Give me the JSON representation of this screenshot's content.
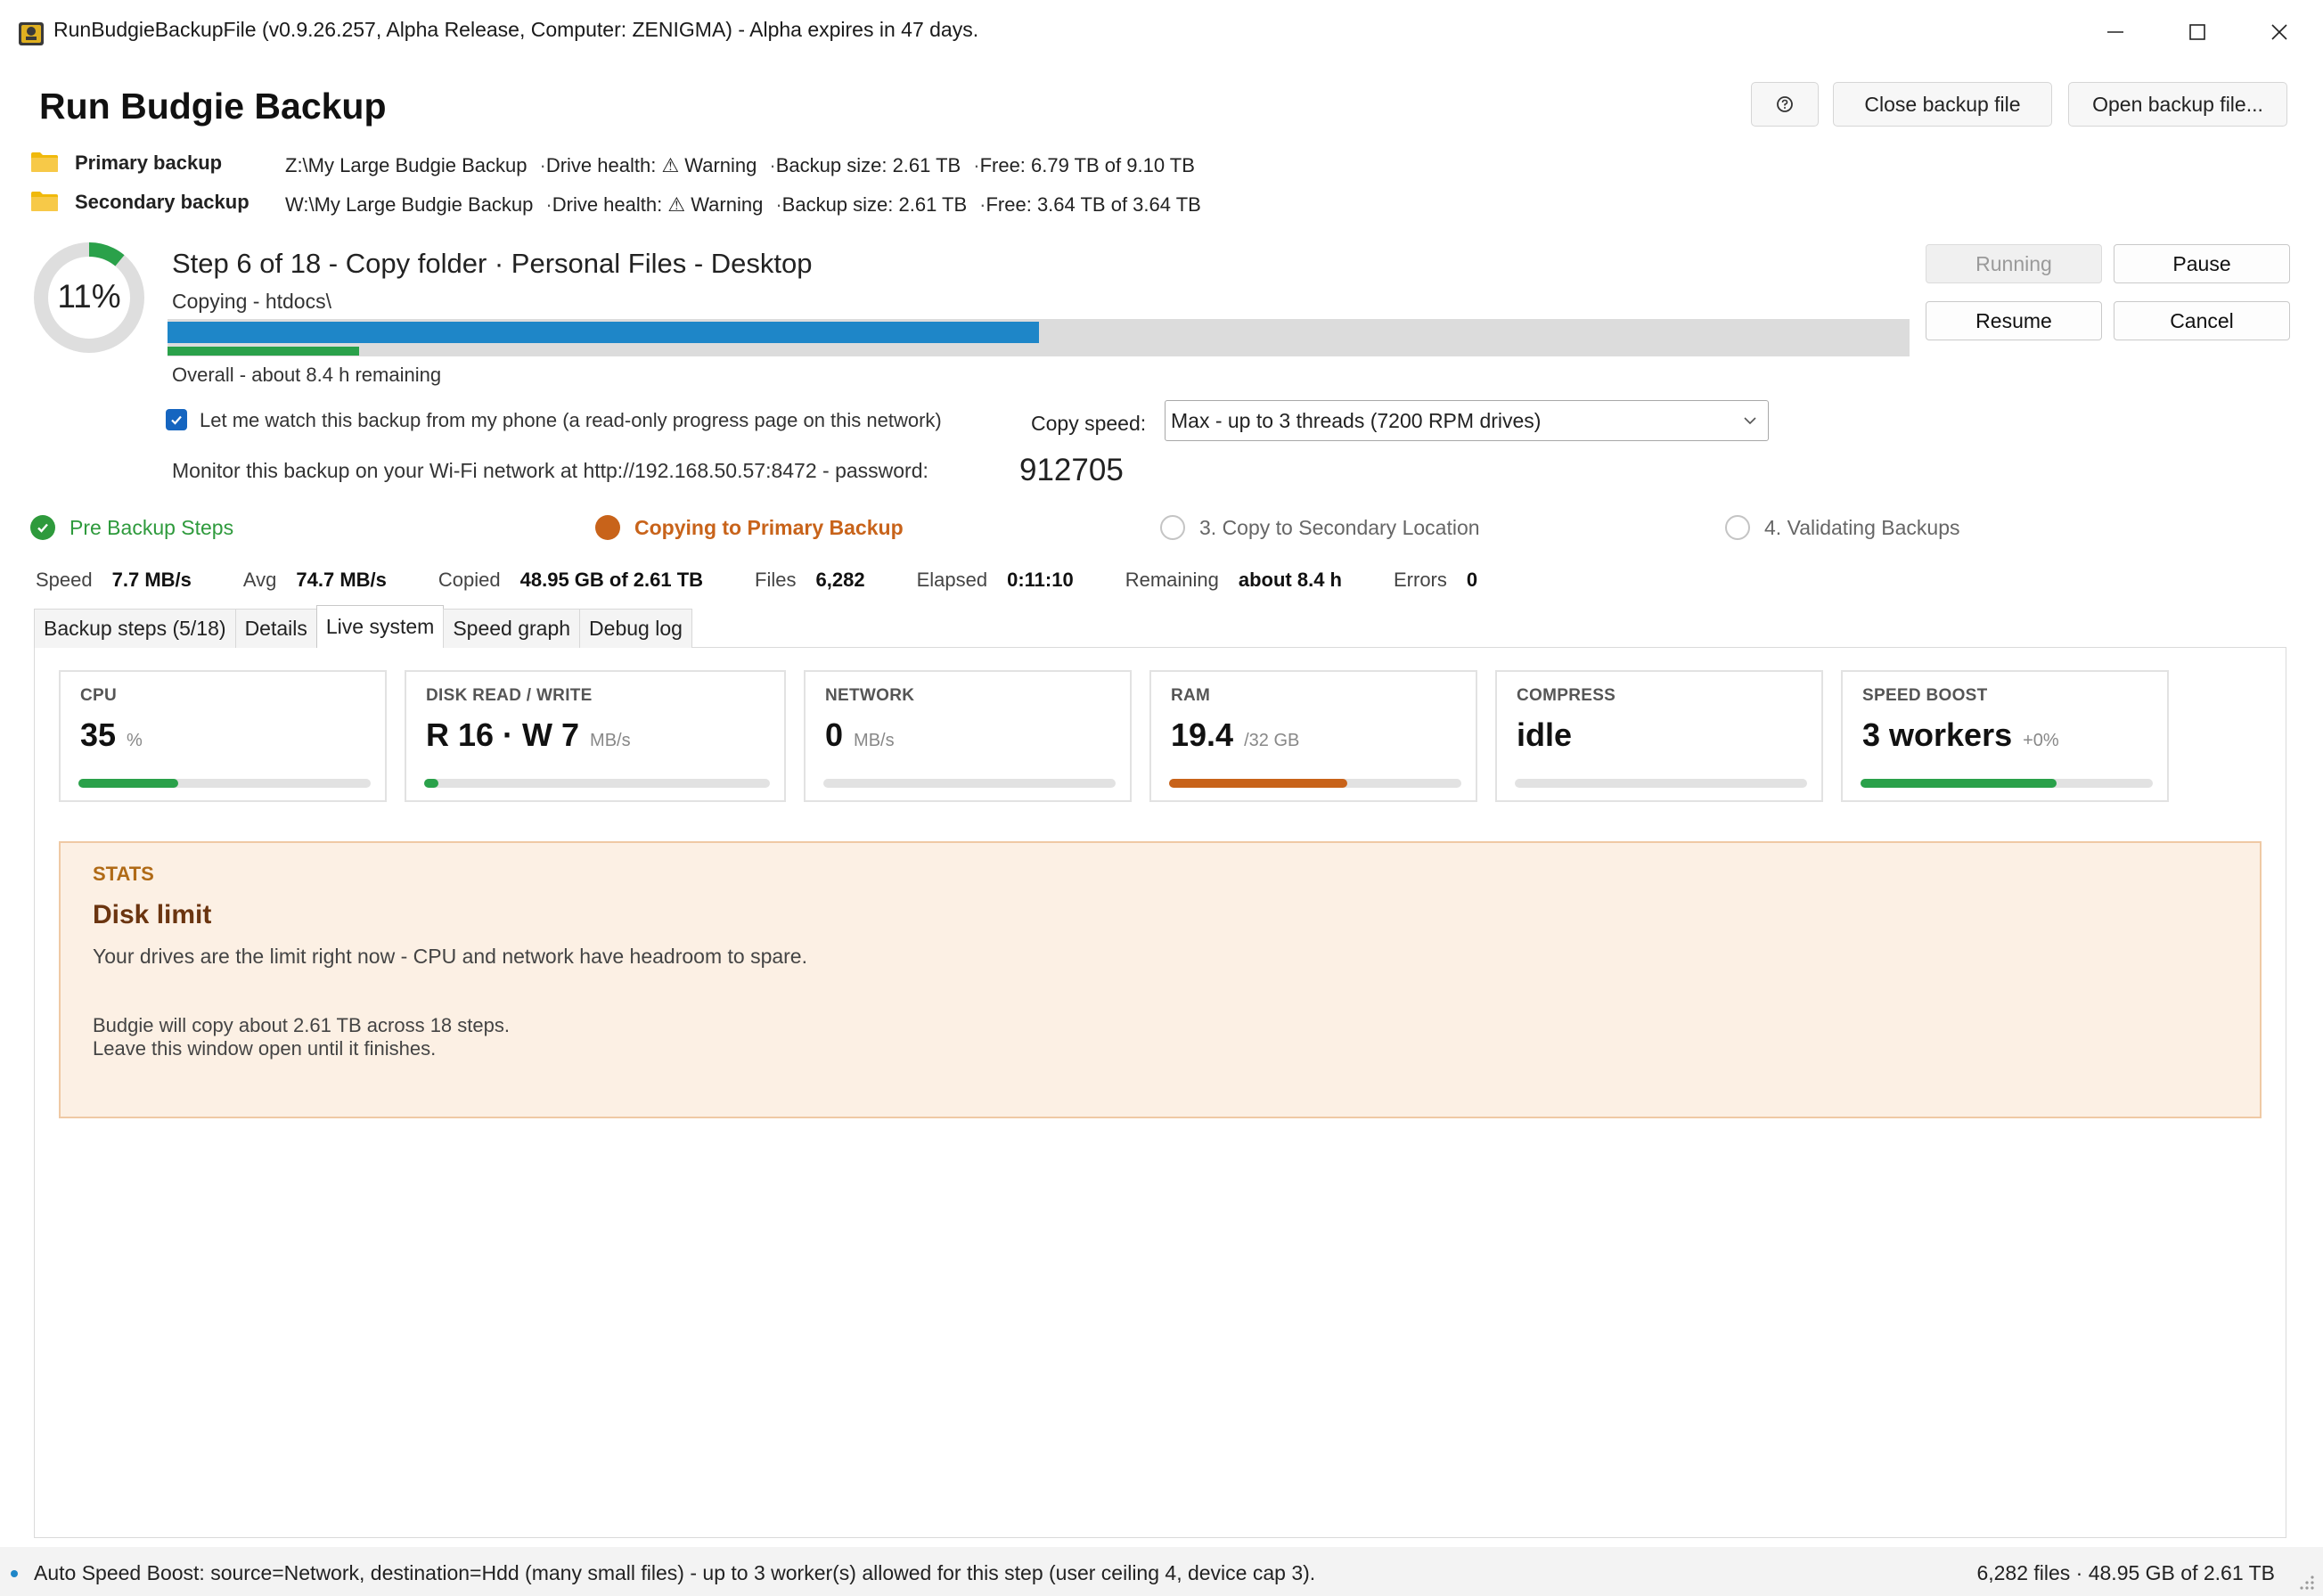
{
  "window": {
    "title": "RunBudgieBackupFile (v0.9.26.257, Alpha Release, Computer: ZENIGMA) - Alpha expires in 47 days."
  },
  "header": {
    "title": "Run Budgie Backup",
    "close_backup_label": "Close backup file",
    "open_backup_label": "Open backup file..."
  },
  "locations": {
    "primary": {
      "label": "Primary backup",
      "path": "Z:\\My Large Budgie Backup",
      "health_label": "Drive health:",
      "health_value": "⚠ Warning",
      "size": "Backup size: 2.61 TB",
      "free": "Free: 6.79 TB of 9.10 TB"
    },
    "secondary": {
      "label": "Secondary backup",
      "path": "W:\\My Large Budgie Backup",
      "health_label": "Drive health:",
      "health_value": "⚠ Warning",
      "size": "Backup size: 2.61 TB",
      "free": "Free: 3.64 TB of 3.64 TB"
    },
    "separator": "·"
  },
  "progress": {
    "percent_label": "11%",
    "percent": 11,
    "step_title": "Step 6 of 18 - Copy folder · Personal Files - Desktop",
    "copying": "Copying - htdocs\\",
    "step_fraction": 0.5,
    "overall_fraction": 0.11,
    "overall_text": "Overall - about 8.4 h remaining"
  },
  "controls": {
    "running_label": "Running",
    "pause_label": "Pause",
    "resume_label": "Resume",
    "cancel_label": "Cancel"
  },
  "watch": {
    "checked": true,
    "label": "Let me watch this backup from my phone (a read-only progress page on this network)"
  },
  "copy_speed": {
    "label": "Copy speed:",
    "selected": "Max - up to 3 threads (7200 RPM drives)"
  },
  "monitor": {
    "text": "Monitor this backup on your Wi-Fi network at  http://192.168.50.57:8472  -  password:",
    "password": "912705"
  },
  "phases": [
    {
      "label": "Pre Backup Steps",
      "state": "done"
    },
    {
      "label": "Copying to Primary Backup",
      "state": "active"
    },
    {
      "label": "3. Copy to Secondary Location",
      "state": "pending"
    },
    {
      "label": "4. Validating Backups",
      "state": "pending"
    }
  ],
  "stats": {
    "speed_label": "Speed",
    "speed": "7.7 MB/s",
    "avg_label": "Avg",
    "avg": "74.7 MB/s",
    "copied_label": "Copied",
    "copied": "48.95 GB of 2.61 TB",
    "files_label": "Files",
    "files": "6,282",
    "elapsed_label": "Elapsed",
    "elapsed": "0:11:10",
    "remaining_label": "Remaining",
    "remaining": "about 8.4 h",
    "errors_label": "Errors",
    "errors": "0"
  },
  "tabs": [
    {
      "label": "Backup steps (5/18)",
      "active": false
    },
    {
      "label": "Details",
      "active": false
    },
    {
      "label": "Live system",
      "active": true
    },
    {
      "label": "Speed graph",
      "active": false
    },
    {
      "label": "Debug log",
      "active": false
    }
  ],
  "cards": [
    {
      "title": "CPU",
      "value": "35",
      "unit": "%",
      "fraction": 0.34,
      "color": "#2aa14a"
    },
    {
      "title": "DISK  READ / WRITE",
      "value": "R 16 · W 7",
      "unit": "MB/s",
      "fraction": 0.04,
      "color": "#2aa14a"
    },
    {
      "title": "NETWORK",
      "value": "0",
      "unit": "MB/s",
      "fraction": 0,
      "color": "#2aa14a"
    },
    {
      "title": "RAM",
      "value": "19.4",
      "unit": "/32 GB",
      "fraction": 0.61,
      "color": "#c8631a"
    },
    {
      "title": "COMPRESS",
      "value": "idle",
      "unit": "",
      "fraction": 0,
      "color": "#2aa14a"
    },
    {
      "title": "SPEED BOOST",
      "value": "3 workers",
      "unit": "+0%",
      "fraction": 0.67,
      "color": "#2aa14a"
    }
  ],
  "stats_box": {
    "heading": "STATS",
    "title": "Disk limit",
    "description": "Your drives are the limit right now - CPU and network have headroom to spare.",
    "note1": "Budgie will copy about 2.61 TB across 18 steps.",
    "note2": "Leave this window open until it finishes."
  },
  "statusbar": {
    "left": "Auto Speed Boost: source=Network, destination=Hdd (many small files) - up to 3 worker(s) allowed for this step (user ceiling 4, device cap 3).",
    "right": "6,282 files · 48.95 GB of 2.61 TB"
  },
  "colors": {
    "accent_blue": "#1e86c8",
    "progress_green": "#2aa14a",
    "active_orange": "#c8631a",
    "done_green": "#2e9a3c"
  },
  "icons": {
    "app": "budgie-app-icon",
    "folder": "folder-icon",
    "help": "help-icon"
  }
}
